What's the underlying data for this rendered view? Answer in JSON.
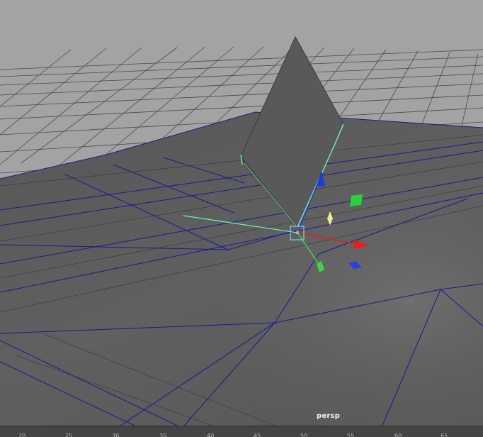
{
  "viewport": {
    "camera_label": "persp",
    "background_color": "#a3a3a3",
    "ground_color": "#5f5f5f",
    "object_color": "#595959",
    "wire_color": "#1a1a8c",
    "selection_color": "#6ff0b4"
  },
  "manipulator": {
    "x_axis_color": "#e0211c",
    "y_axis_color": "#1c3cdc",
    "z_axis_color": "#3fd14a",
    "plane_handle_color": "#26d43a",
    "center_handle_color": "#7ad3ee",
    "free_handle_color": "#f4e88a",
    "icon": "move-tool-manipulator"
  },
  "timeline": {
    "ticks": [
      "20",
      "25",
      "30",
      "35",
      "40",
      "45",
      "50",
      "55",
      "60",
      "65"
    ]
  }
}
